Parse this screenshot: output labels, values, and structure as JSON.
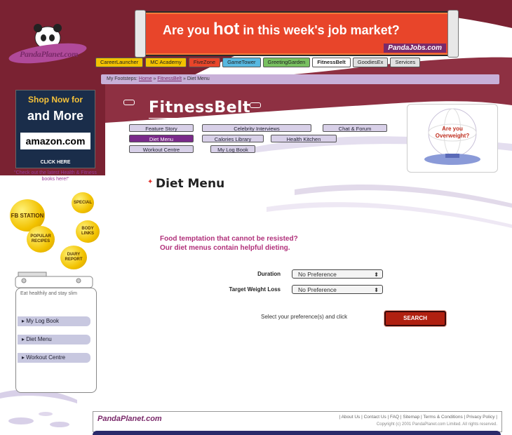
{
  "brand": {
    "logo_text": "PandaPlanet.com"
  },
  "banner": {
    "pre": "Are you ",
    "hot": "hot",
    "post": " in this week's job market?",
    "brand": "PandaJobs.com"
  },
  "nav_tabs": [
    {
      "label": "CareerLauncher",
      "color": "#f2c200"
    },
    {
      "label": "MC Academy",
      "color": "#f2c200"
    },
    {
      "label": "FiveZone",
      "color": "#e8452a"
    },
    {
      "label": "GameTower",
      "color": "#58b8e0"
    },
    {
      "label": "GreetingGarden",
      "color": "#78c060"
    },
    {
      "label": "FitnessBelt",
      "color": "#ffffff"
    },
    {
      "label": "GoodiesEx",
      "color": "#e0e0e0"
    },
    {
      "label": "Services",
      "color": "#e0e0e0"
    }
  ],
  "breadcrumb": {
    "prefix": "My Footsteps:",
    "home": "Home",
    "sep1": " » ",
    "section": "FitnessBelt",
    "sep2": " » ",
    "current": "Diet Menu"
  },
  "amazon": {
    "line1": "Shop Now for",
    "line2": "and More",
    "logo": "amazon.com",
    "cta": "CLICK HERE",
    "caption": "\"Check out the latest Health & Fitness books here!\""
  },
  "bubbles": [
    "FB STATION",
    "SPECIAL",
    "POPULAR RECIPES",
    "BODY LINKS",
    "DIARY REPORT"
  ],
  "left_menu": {
    "title": "Eat healthily and stay slim",
    "items": [
      "My Log Book",
      "Diet Menu",
      "Workout Centre"
    ]
  },
  "section_title": "FitnessBelt",
  "sub_nav": [
    "Feature Story",
    "Celebrity Interviews",
    "Chat & Forum",
    "Diet Menu",
    "Calories Library",
    "Health Kitchen",
    "Workout Centre",
    "My Log Book"
  ],
  "promo": {
    "line1": "Are you",
    "line2": "Overweight?"
  },
  "page_title": "Diet Menu",
  "intro": {
    "line1": "Food temptation that cannot be resisted?",
    "line2": "Our diet menus contain helpful dieting."
  },
  "form": {
    "duration_label": "Duration",
    "duration_value": "No Preference",
    "weight_label": "Target Weight Loss",
    "weight_value": "No Preference",
    "hint": "Select your preference(s) and click",
    "search_label": "SEARCH"
  },
  "footer": {
    "brand": "PandaPlanet.com",
    "links": "| About Us | Contact Us | FAQ | Sitemap | Terms & Conditions | Privacy Policy |",
    "copyright": "Copyright (c) 2001 PandaPlanet.com Limited. All rights reserved."
  }
}
